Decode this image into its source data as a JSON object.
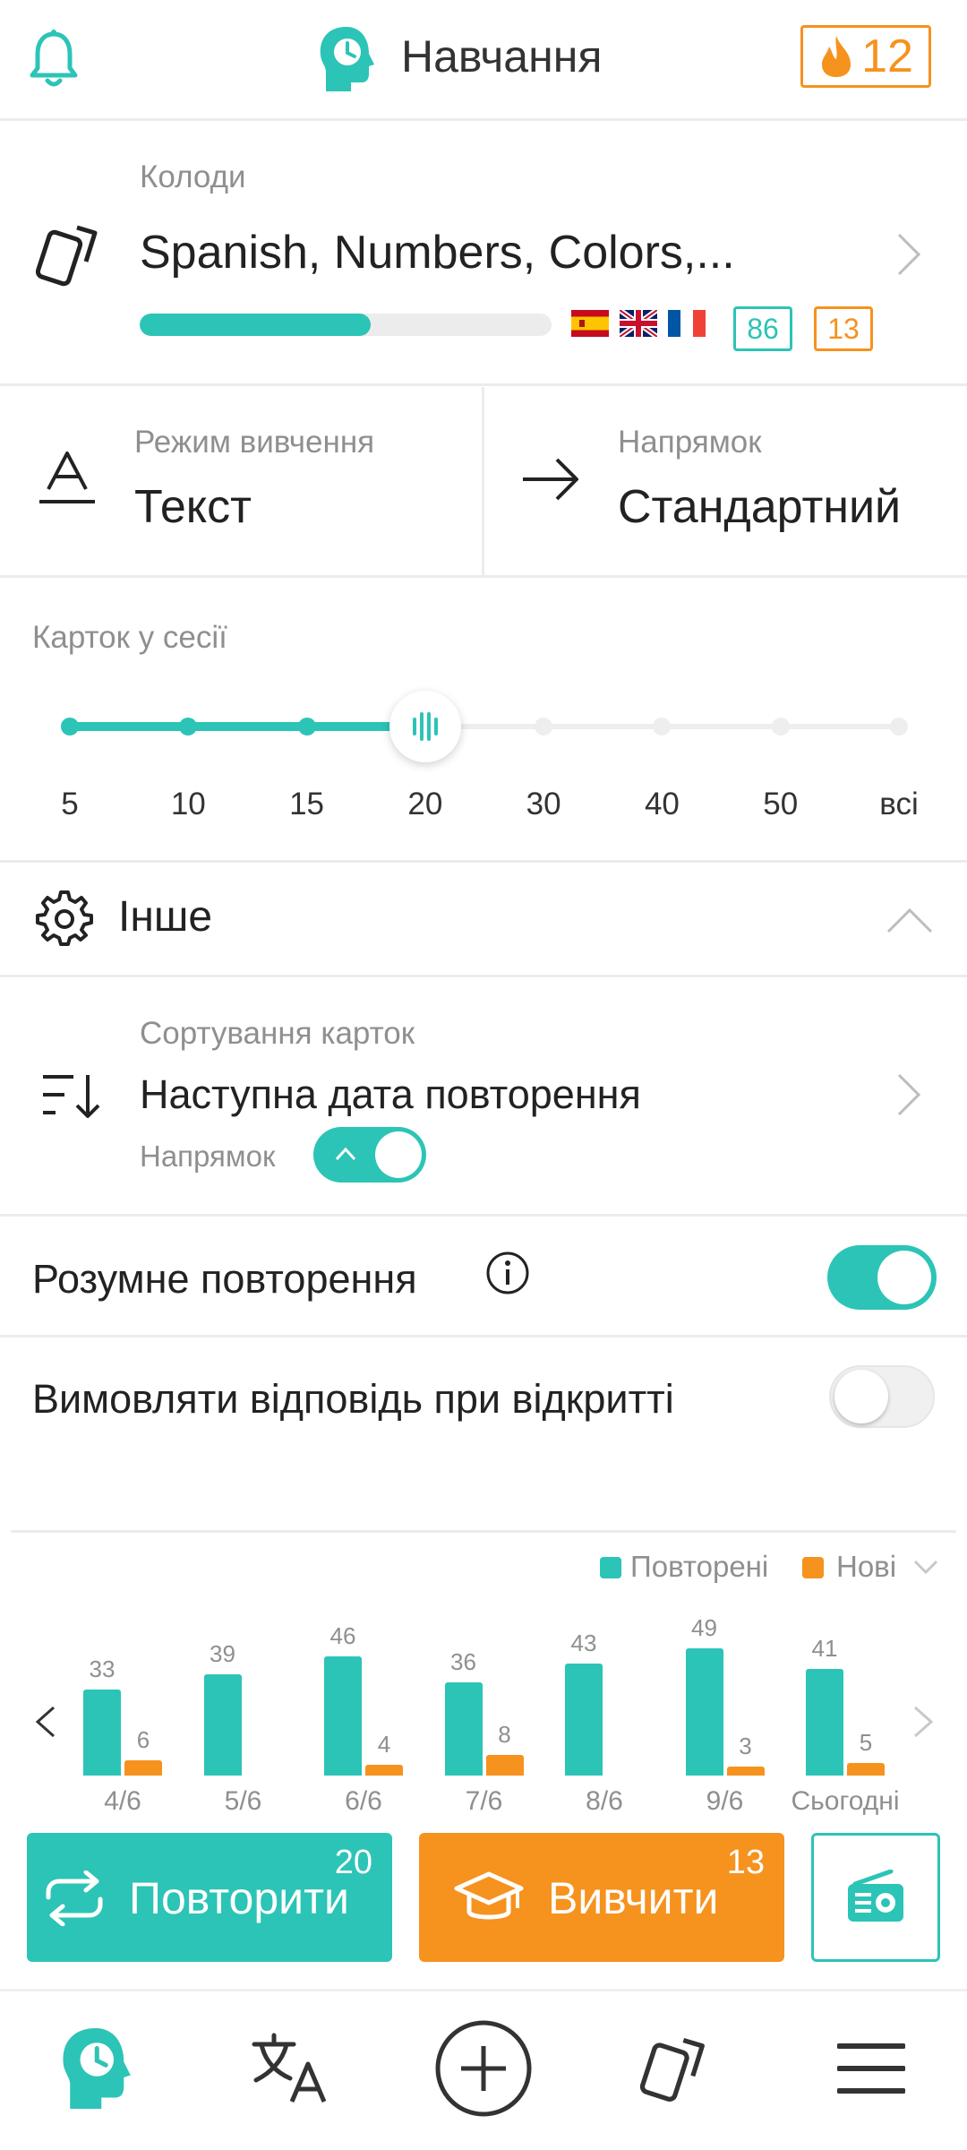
{
  "header": {
    "title": "Навчання",
    "streak": "12"
  },
  "decks": {
    "label": "Колоди",
    "title": "Spanish, Numbers, Colors,...",
    "progress": 0.56,
    "badge_teal": "86",
    "badge_orange": "13"
  },
  "mode": {
    "label": "Режим вивчення",
    "value": "Текст"
  },
  "direction": {
    "label": "Напрямок",
    "value": "Стандартний"
  },
  "cards_in_session": {
    "label": "Карток у сесії",
    "stops": [
      "5",
      "10",
      "15",
      "20",
      "30",
      "40",
      "50",
      "всі"
    ],
    "selected": "20"
  },
  "other": {
    "label": "Інше"
  },
  "sorting": {
    "label": "Сортування карток",
    "value": "Наступна дата повторення",
    "direction_label": "Напрямок"
  },
  "smart_repeat": {
    "label": "Розумне повторення",
    "enabled": true
  },
  "speak_answer": {
    "label": "Вимовляти відповідь при відкритті",
    "enabled": false
  },
  "chart_data": {
    "type": "bar",
    "categories": [
      "4/6",
      "5/6",
      "6/6",
      "7/6",
      "8/6",
      "9/6",
      "Сьогодні"
    ],
    "series": [
      {
        "name": "Повторені",
        "values": [
          33,
          39,
          46,
          36,
          43,
          49,
          41
        ],
        "color": "#2cc4b6"
      },
      {
        "name": "Нові",
        "values": [
          6,
          null,
          4,
          8,
          null,
          3,
          5
        ],
        "color": "#f6921e"
      }
    ],
    "legend": "top-right"
  },
  "actions": {
    "review_label": "Повторити",
    "review_count": "20",
    "learn_label": "Вивчити",
    "learn_count": "13"
  },
  "colors": {
    "accent": "#2cc4b6",
    "orange": "#f6921e"
  },
  "nav": [
    "brain-clock-icon",
    "translate-icon",
    "add-circle-icon",
    "cards-icon",
    "menu-icon"
  ]
}
